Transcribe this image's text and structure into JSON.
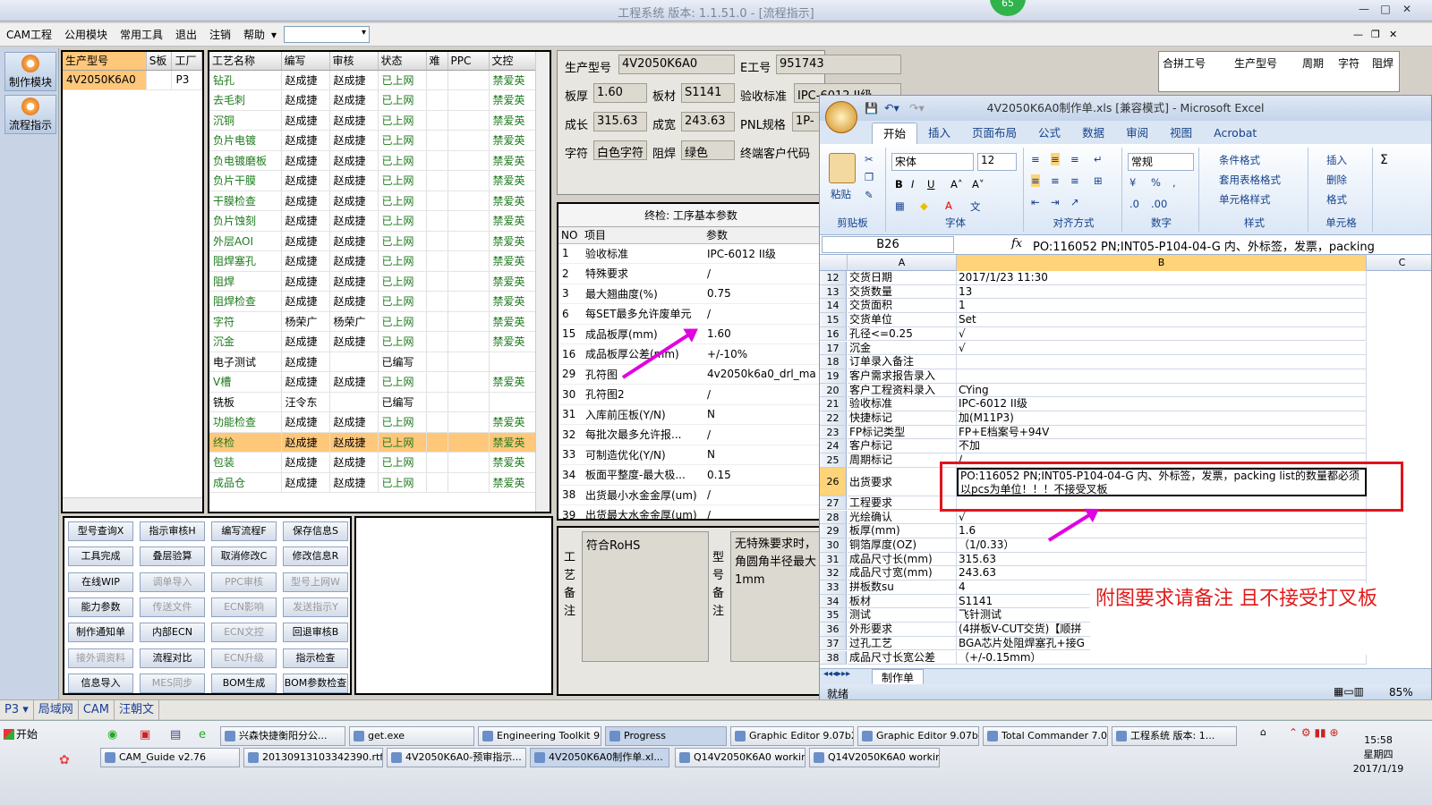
{
  "window": {
    "title": "工程系统  版本: 1.1.51.0 - [流程指示]",
    "badge": "65"
  },
  "menu": [
    "CAM工程",
    "公用模块",
    "常用工具",
    "退出",
    "注销",
    "帮助"
  ],
  "left_nav": [
    "制作模块",
    "流程指示"
  ],
  "orders": {
    "headers": [
      "生产型号",
      "S板",
      "工厂"
    ],
    "rows": [
      [
        "4V2050K6A0",
        "",
        "P3"
      ]
    ]
  },
  "process": {
    "headers": [
      "工艺名称",
      "编写",
      "审核",
      "状态",
      "难",
      "PPC",
      "文控"
    ],
    "rows": [
      [
        "钻孔",
        "赵成捷",
        "赵成捷",
        "已上网",
        "",
        "",
        "禁爱英"
      ],
      [
        "去毛刺",
        "赵成捷",
        "赵成捷",
        "已上网",
        "",
        "",
        "禁爱英"
      ],
      [
        "沉铜",
        "赵成捷",
        "赵成捷",
        "已上网",
        "",
        "",
        "禁爱英"
      ],
      [
        "负片电镀",
        "赵成捷",
        "赵成捷",
        "已上网",
        "",
        "",
        "禁爱英"
      ],
      [
        "负电镀磨板",
        "赵成捷",
        "赵成捷",
        "已上网",
        "",
        "",
        "禁爱英"
      ],
      [
        "负片干膜",
        "赵成捷",
        "赵成捷",
        "已上网",
        "",
        "",
        "禁爱英"
      ],
      [
        "干膜检查",
        "赵成捷",
        "赵成捷",
        "已上网",
        "",
        "",
        "禁爱英"
      ],
      [
        "负片蚀刻",
        "赵成捷",
        "赵成捷",
        "已上网",
        "",
        "",
        "禁爱英"
      ],
      [
        "外层AOI",
        "赵成捷",
        "赵成捷",
        "已上网",
        "",
        "",
        "禁爱英"
      ],
      [
        "阻焊塞孔",
        "赵成捷",
        "赵成捷",
        "已上网",
        "",
        "",
        "禁爱英"
      ],
      [
        "阻焊",
        "赵成捷",
        "赵成捷",
        "已上网",
        "",
        "",
        "禁爱英"
      ],
      [
        "阻焊检查",
        "赵成捷",
        "赵成捷",
        "已上网",
        "",
        "",
        "禁爱英"
      ],
      [
        "字符",
        "杨荣广",
        "杨荣广",
        "已上网",
        "",
        "",
        "禁爱英"
      ],
      [
        "沉金",
        "赵成捷",
        "赵成捷",
        "已上网",
        "",
        "",
        "禁爱英"
      ],
      [
        "电子测试",
        "赵成捷",
        "",
        "已编写",
        "",
        "",
        ""
      ],
      [
        "V槽",
        "赵成捷",
        "赵成捷",
        "已上网",
        "",
        "",
        "禁爱英"
      ],
      [
        "铣板",
        "汪令东",
        "",
        "已编写",
        "",
        "",
        ""
      ],
      [
        "功能检查",
        "赵成捷",
        "赵成捷",
        "已上网",
        "",
        "",
        "禁爱英"
      ],
      [
        "终检",
        "赵成捷",
        "赵成捷",
        "已上网",
        "",
        "",
        "禁爱英"
      ],
      [
        "包装",
        "赵成捷",
        "赵成捷",
        "已上网",
        "",
        "",
        "禁爱英"
      ],
      [
        "成品仓",
        "赵成捷",
        "赵成捷",
        "已上网",
        "",
        "",
        "禁爱英"
      ]
    ],
    "selected_index": 18
  },
  "buttons": [
    [
      "型号查询X",
      "指示审核H",
      "编写流程F",
      "保存信息S"
    ],
    [
      "工具完成",
      "叠层验算",
      "取消修改C",
      "修改信息R"
    ],
    [
      "在线WIP",
      "调单导入",
      "PPC审核",
      "型号上网W"
    ],
    [
      "能力参数",
      "传送文件",
      "ECN影响",
      "发送指示Y"
    ],
    [
      "制作通知单",
      "内部ECN",
      "ECN文控",
      "回退审核B"
    ],
    [
      "接外调资料",
      "流程对比",
      "ECN升级",
      "指示检查"
    ],
    [
      "信息导入",
      "MES同步",
      "BOM生成",
      "BOM参数检查"
    ]
  ],
  "disabled_buttons": [
    "调单导入",
    "PPC审核",
    "型号上网W",
    "传送文件",
    "ECN影响",
    "发送指示Y",
    "ECN文控",
    "接外调资料",
    "ECN升级",
    "MES同步"
  ],
  "info": {
    "model_label": "生产型号",
    "model": "4V2050K6A0",
    "e_label": "E工号",
    "e_no": "951743",
    "thick_label": "板厚",
    "thick": "1.60",
    "mat_label": "板材",
    "mat": "S1141",
    "std_label": "验收标准",
    "std": "IPC-6012 II级",
    "len_label": "成长",
    "len": "315.63",
    "wid_label": "成宽",
    "wid": "243.63",
    "pnl_label": "PNL规格",
    "pnl": "1P-",
    "char_label": "字符",
    "char": "白色字符",
    "mask_label": "阻焊",
    "mask": "绿色",
    "cust_label": "终端客户代码"
  },
  "params": {
    "title": "终检: 工序基本参数",
    "headers": [
      "NO",
      "项目",
      "参数"
    ],
    "rows": [
      [
        "1",
        "验收标准",
        "IPC-6012 II级"
      ],
      [
        "2",
        "特殊要求",
        "/"
      ],
      [
        "3",
        "最大翘曲度(%)",
        "0.75"
      ],
      [
        "6",
        "每SET最多允许废单元",
        "/"
      ],
      [
        "15",
        "成品板厚(mm)",
        "1.60"
      ],
      [
        "16",
        "成品板厚公差(mm)",
        "+/-10%"
      ],
      [
        "29",
        "孔符图",
        "4v2050k6a0_drl_ma"
      ],
      [
        "30",
        "孔符图2",
        "/"
      ],
      [
        "31",
        "入库前压板(Y/N)",
        "N"
      ],
      [
        "32",
        "每批次最多允许报...",
        "/"
      ],
      [
        "33",
        "可制造优化(Y/N)",
        "N"
      ],
      [
        "34",
        "板面平整度-最大极...",
        "0.15"
      ],
      [
        "38",
        "出货最小水金金厚(um)",
        "/"
      ],
      [
        "39",
        "出货最大水金金厚(um)",
        "/"
      ]
    ]
  },
  "notes": {
    "proc_label": "工艺备注",
    "proc_text": "符合RoHS",
    "model_label": "型号备注",
    "model_text": "无特殊要求时，角圆角半径最大1mm"
  },
  "right_header": [
    "合拼工号",
    "生产型号",
    "周期",
    "字符",
    "阻焊"
  ],
  "excel": {
    "title": "4V2050K6A0制作单.xls [兼容模式] - Microsoft Excel",
    "tabs": [
      "开始",
      "插入",
      "页面布局",
      "公式",
      "数据",
      "审阅",
      "视图",
      "Acrobat"
    ],
    "groups": [
      "剪贴板",
      "字体",
      "对齐方式",
      "数字",
      "样式",
      "单元格"
    ],
    "font": "宋体",
    "size": "12",
    "numfmt": "常规",
    "paste": "粘贴",
    "styles": [
      "条件格式",
      "套用表格格式",
      "单元格样式"
    ],
    "cells_btns": [
      "插入",
      "删除",
      "格式"
    ],
    "namebox": "B26",
    "fx": "fx",
    "formula": "PO:116052 PN;INT05-P104-04-G 内、外标签，发票，packing",
    "cols": [
      "A",
      "B",
      "C"
    ],
    "rows": [
      [
        "12",
        "交货日期",
        "2017/1/23 11:30"
      ],
      [
        "13",
        "交货数量",
        "13"
      ],
      [
        "14",
        "交货面积",
        "1"
      ],
      [
        "15",
        "交货单位",
        "Set"
      ],
      [
        "16",
        "孔径<=0.25",
        "√"
      ],
      [
        "17",
        "沉金",
        "√"
      ],
      [
        "18",
        "订单录入备注",
        ""
      ],
      [
        "19",
        "客户需求报告录入",
        ""
      ],
      [
        "20",
        "客户工程资料录入",
        "CYing"
      ],
      [
        "21",
        "验收标准",
        "IPC-6012 II级"
      ],
      [
        "22",
        "快捷标记",
        "加(M11P3)"
      ],
      [
        "23",
        "FP标记类型",
        "FP+E档案号+94V"
      ],
      [
        "24",
        "客户标记",
        "不加"
      ],
      [
        "25",
        "周期标记",
        "/"
      ],
      [
        "26",
        "出货要求",
        "PO:116052 PN;INT05-P104-04-G 内、外标签，发票，packing list的数量都必须以pcs为单位！！！不接受叉板"
      ],
      [
        "27",
        "工程要求",
        ""
      ],
      [
        "28",
        "光绘确认",
        "√"
      ],
      [
        "29",
        "板厚(mm)",
        "1.6"
      ],
      [
        "30",
        "铜箔厚度(OZ)",
        "（1/0.33）"
      ],
      [
        "31",
        "成品尺寸长(mm)",
        "315.63"
      ],
      [
        "32",
        "成品尺寸宽(mm)",
        "243.63"
      ],
      [
        "33",
        "拼板数su",
        "4"
      ],
      [
        "34",
        "板材",
        "S1141"
      ],
      [
        "35",
        "测试",
        "飞针测试"
      ],
      [
        "36",
        "外形要求",
        "(4拼板V-CUT交货)【顺拼"
      ],
      [
        "37",
        "过孔工艺",
        "BGA芯片处阻焊塞孔+接G"
      ],
      [
        "38",
        "成品尺寸长宽公差",
        "（+/-0.15mm）"
      ]
    ],
    "sheet_tab": "制作单",
    "status": "就绪",
    "zoom": "85"
  },
  "callout": "附图要求请备注 且不接受打叉板",
  "status": [
    "P3",
    "局域网",
    "CAM",
    "汪朝文"
  ],
  "taskbar": {
    "start": "开始",
    "row1": [
      "兴森快捷衡阳分公...",
      "get.exe",
      "Engineering Toolkit 9....",
      "Progress",
      "Graphic Editor 9.07b2...",
      "Graphic Editor 9.07b2...",
      "Total Commander 7.0...",
      "工程系统  版本: 1..."
    ],
    "row2": [
      "CAM_Guide v2.76",
      "20130913103342390.rtf...",
      "4V2050K6A0-预审指示...",
      "4V2050K6A0制作单.xl...",
      "Q14V2050K6A0 working ...",
      "Q14V2050K6A0 working ..."
    ],
    "time": "15:58",
    "weekday": "星期四",
    "date": "2017/1/19"
  }
}
